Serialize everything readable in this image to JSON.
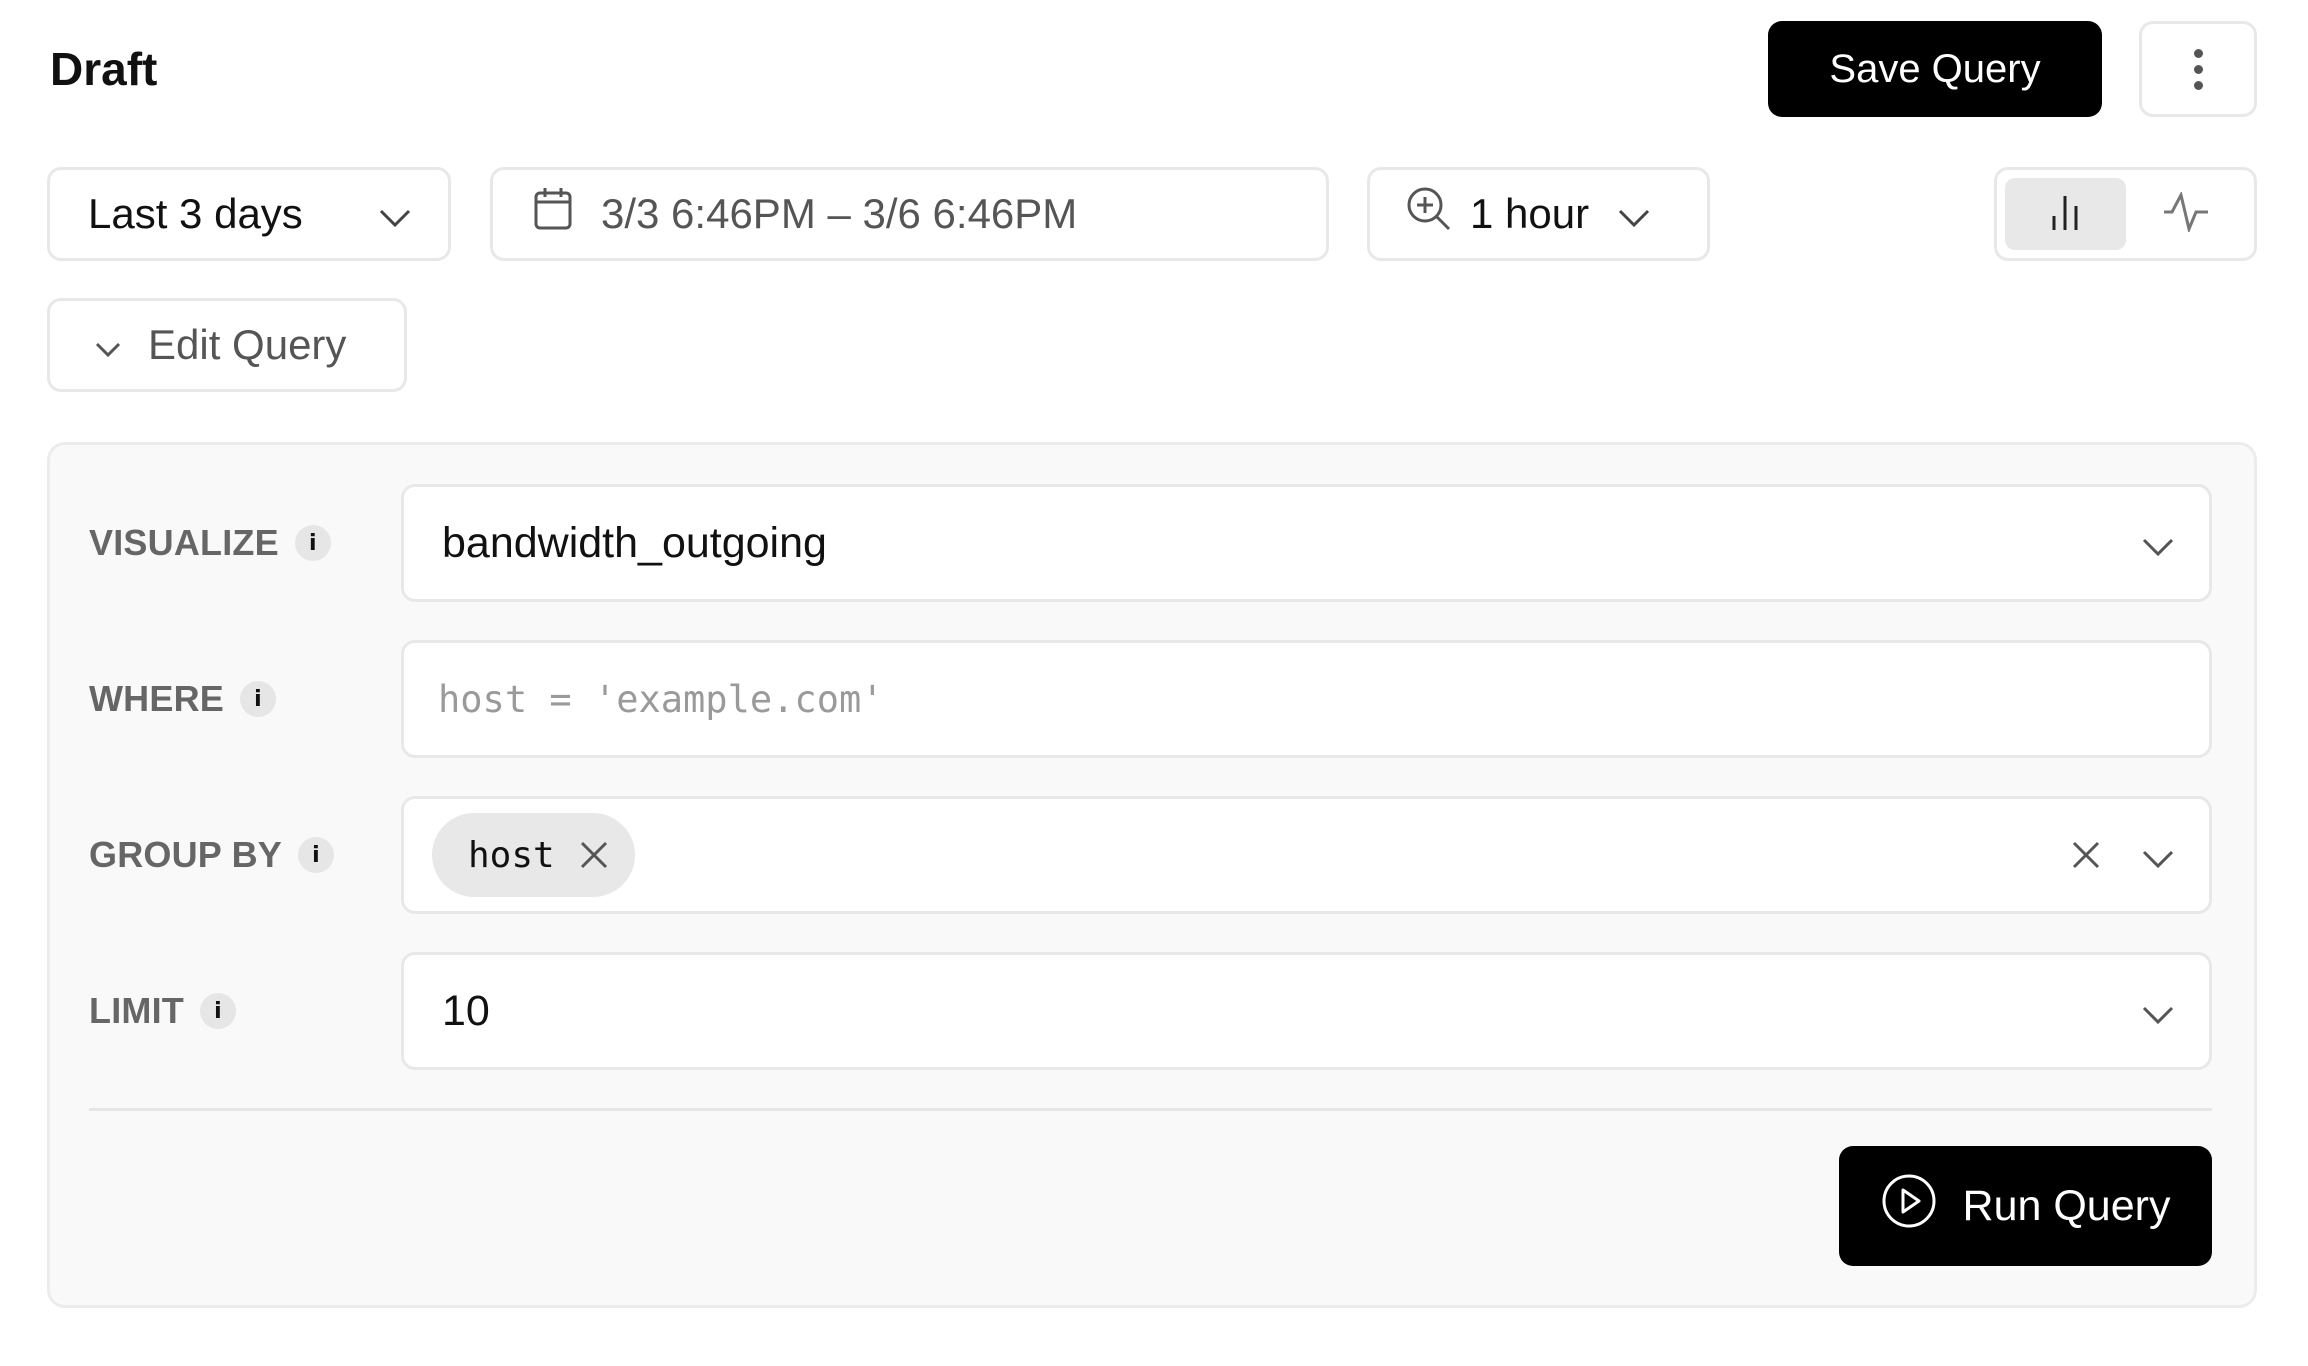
{
  "header": {
    "title": "Draft",
    "save_label": "Save Query",
    "more_icon": "kebab-vertical-icon"
  },
  "toolbar": {
    "time_range": {
      "label": "Last 3 days",
      "icon": "chevron-down-icon"
    },
    "date_range": {
      "label": "3/3 6:46PM – 3/6 6:46PM",
      "icon": "calendar-icon"
    },
    "granularity": {
      "label": "1 hour",
      "icon": "zoom-in-icon"
    },
    "chart_type_toggle": {
      "options": [
        {
          "name": "bar-chart",
          "icon": "bar-chart-icon",
          "active": true
        },
        {
          "name": "line-chart",
          "icon": "line-chart-icon",
          "active": false
        }
      ]
    }
  },
  "edit_query": {
    "label": "Edit Query",
    "expanded": true
  },
  "query": {
    "visualize": {
      "label": "VISUALIZE",
      "value": "bandwidth_outgoing"
    },
    "where": {
      "label": "WHERE",
      "value": "",
      "placeholder": "host = 'example.com'"
    },
    "group_by": {
      "label": "GROUP BY",
      "chips": [
        "host"
      ]
    },
    "limit": {
      "label": "LIMIT",
      "value": "10"
    },
    "info_glyph": "i",
    "run_label": "Run Query"
  },
  "colors": {
    "primary_button": "#000000",
    "panel_background": "#f9f9f9",
    "border": "#e8e8e8",
    "label_text": "#666666"
  }
}
